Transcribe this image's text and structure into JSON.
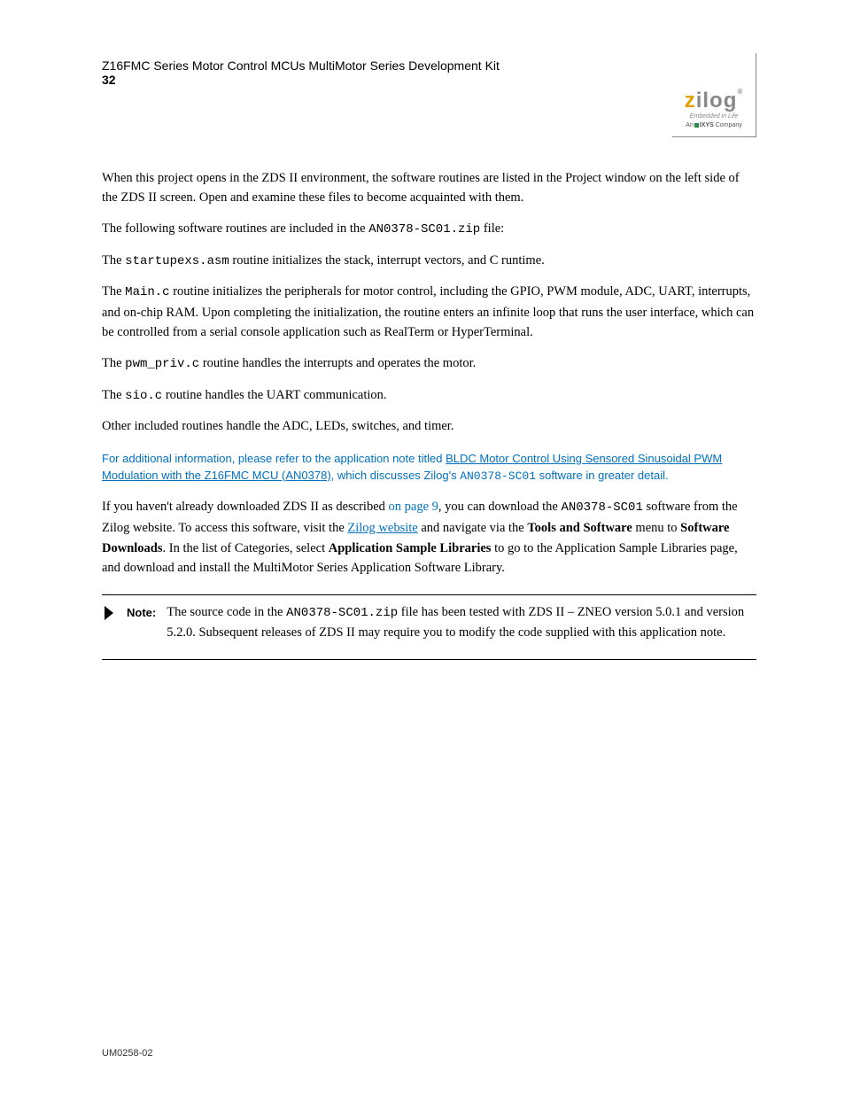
{
  "header": {
    "doc_title": "Z16FMC Series Motor Control MCUs MultiMotor Series Development Kit",
    "page_number": "32",
    "logo": {
      "z": "z",
      "ilog": "ilog",
      "reg": "®",
      "sub1": "Embedded in Life",
      "sub2_a": "An",
      "sub2_b": "IXYS",
      "sub2_c": "Company"
    }
  },
  "body": {
    "p1": "When this project opens in the ZDS II environment, the software routines are listed in the Project window on the left side of the ZDS II screen. Open and examine these files to become acquainted with them.",
    "p2": "The following software routines are included in the ",
    "p2_file": "AN0378-SC01.zip",
    "p2_tail": " file:",
    "li1_pre": "The ",
    "li1_file": "startupexs.asm",
    "li1_post": " routine initializes the stack, interrupt vectors, and C runtime.",
    "li2_pre": "The ",
    "li2_file": "Main.c",
    "li2_post": " routine initializes the peripherals for motor control, including the GPIO, PWM module, ADC, UART, interrupts, and on-chip RAM. Upon completing the initialization, the routine enters an infinite loop that runs the user interface, which can be controlled from a serial console application such as RealTerm or HyperTerminal.",
    "li3_pre": "The ",
    "li3_file": "pwm_priv.c",
    "li3_post": " routine handles the interrupts and operates the motor.",
    "li4_pre": "The ",
    "li4_file": "sio.c",
    "li4_post": " routine handles the UART communication.",
    "li5_pre": "Other included routines handle the ADC, LEDs, switches, and timer.",
    "note_hl_a": "For additional information, please refer to the application note titled ",
    "note_hl_link": "BLDC Motor Control Using Sensored Sinusoidal PWM Modulation with the Z16FMC MCU (AN0378)",
    "note_hl_b": ", which discusses Zilog's ",
    "note_hl_code": "AN0378-SC01",
    "note_hl_c": " software in greater detail.",
    "p3a": "If you haven't already downloaded ZDS II as described ",
    "p3b": "on page 9",
    "p3c": ", you can download the ",
    "p3_code1": "AN0378-SC01",
    "p3d": " software from the Zilog website. To access this software, visit the ",
    "p3_link": "Zilog website",
    "p3e": " and navigate via the ",
    "p3_bold1": "Tools and Software",
    "p3f": " menu to ",
    "p3_bold2": "Software Downloads",
    "p3g": ". In the list of Categories, select ",
    "p3_bold3": "Application Sample Libraries",
    "p3h": " to go to the Application Sample Libraries page, and download and install the MultiMotor Series Application Software Library."
  },
  "note": {
    "label": "Note:",
    "text_a": "The source code in the ",
    "code": "AN0378-SC01.zip",
    "text_b": " file has been tested with ZDS II – ZNEO version 5.0.1 and version 5.2.0. Subsequent releases of ZDS II may require you to modify the code supplied with this application note."
  },
  "footer": {
    "text": "UM0258-02"
  }
}
